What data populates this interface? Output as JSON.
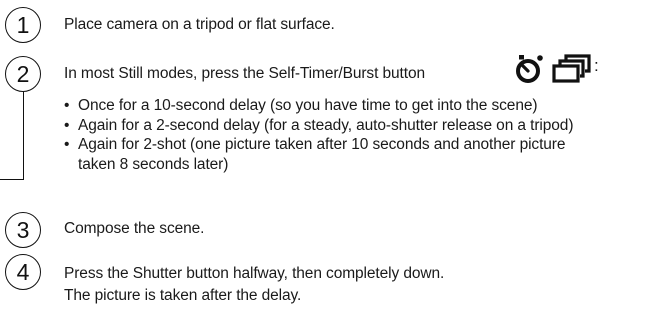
{
  "steps": [
    {
      "number": "1",
      "text": "Place camera on a tripod or flat surface."
    },
    {
      "number": "2",
      "text": "In most Still modes, press the Self-Timer/Burst button",
      "suffix": ":"
    },
    {
      "number": "3",
      "text": "Compose the scene."
    },
    {
      "number": "4",
      "text": "Press the Shutter button halfway, then completely down.",
      "text2": "The picture is taken after the delay."
    }
  ],
  "bullets": [
    {
      "line1": "Once for a 10-second delay (so you have time to get into the scene)"
    },
    {
      "line1": "Again for a 2-second delay (for a steady, auto-shutter release on a tripod)"
    },
    {
      "line1": "Again for 2-shot (one picture taken after 10 seconds and another picture",
      "line2": "taken 8 seconds later)"
    }
  ],
  "icons": [
    "self-timer-icon",
    "burst-icon"
  ]
}
